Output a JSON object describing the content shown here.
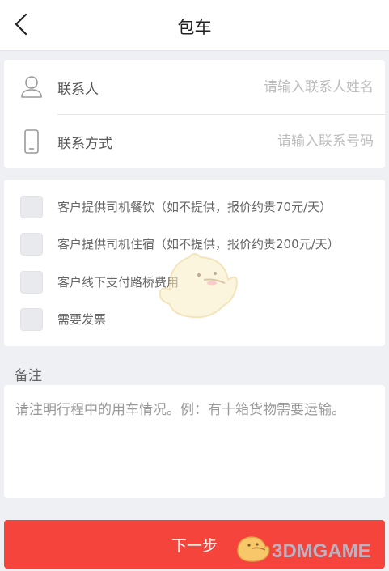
{
  "header": {
    "title": "包车"
  },
  "contact": {
    "name_label": "联系人",
    "name_placeholder": "请输入联系人姓名",
    "phone_label": "联系方式",
    "phone_placeholder": "请输入联系号码",
    "name_icon": "person-icon",
    "phone_icon": "phone-icon"
  },
  "options": [
    {
      "label": "客户提供司机餐饮（如不提供，报价约贵70元/天）",
      "checked": false
    },
    {
      "label": "客户提供司机住宿（如不提供，报价约贵200元/天）",
      "checked": false
    },
    {
      "label": "客户线下支付路桥费用",
      "checked": false
    },
    {
      "label": "需要发票",
      "checked": false
    }
  ],
  "remarks": {
    "title": "备注",
    "placeholder": "请注明行程中的用车情况。例：有十箱货物需要运输。"
  },
  "next_button": {
    "label": "下一步"
  },
  "watermark": {
    "text": "3DMGAME"
  },
  "colors": {
    "accent": "#f5443b",
    "background": "#eef0f4"
  }
}
